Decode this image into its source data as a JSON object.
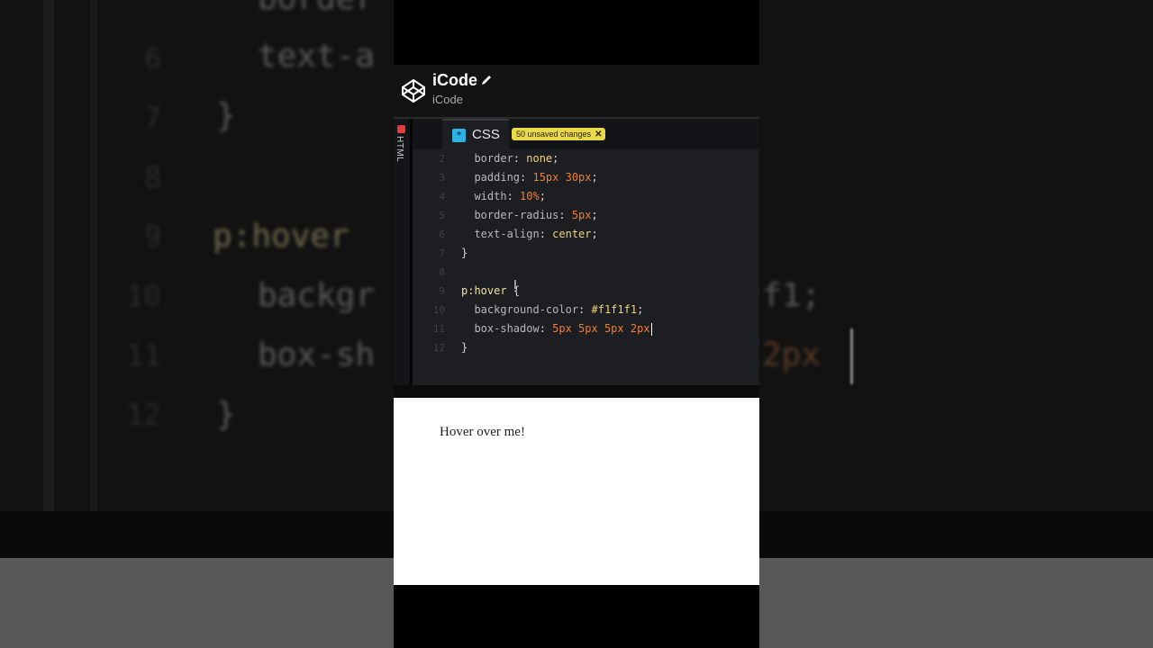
{
  "app": {
    "title": "iCode",
    "subtitle": "iCode",
    "logo_icon": "codepen-logo-icon",
    "edit_icon": "pencil-icon"
  },
  "editor": {
    "side_tab_label": "HTML",
    "active_tab": "CSS",
    "unsaved_badge": "50 unsaved changes",
    "unsaved_close": "✕",
    "lines": [
      {
        "num": "2",
        "tokens": [
          [
            "prop",
            "  border"
          ],
          [
            "punc",
            ": "
          ],
          [
            "val-yellow",
            "none"
          ],
          [
            "punc",
            ";"
          ]
        ]
      },
      {
        "num": "3",
        "tokens": [
          [
            "prop",
            "  padding"
          ],
          [
            "punc",
            ": "
          ],
          [
            "val-orange",
            "15px 30px"
          ],
          [
            "punc",
            ";"
          ]
        ]
      },
      {
        "num": "4",
        "tokens": [
          [
            "prop",
            "  width"
          ],
          [
            "punc",
            ": "
          ],
          [
            "val-orange",
            "10%"
          ],
          [
            "punc",
            ";"
          ]
        ]
      },
      {
        "num": "5",
        "tokens": [
          [
            "prop",
            "  border-radius"
          ],
          [
            "punc",
            ": "
          ],
          [
            "val-orange",
            "5px"
          ],
          [
            "punc",
            ";"
          ]
        ]
      },
      {
        "num": "6",
        "tokens": [
          [
            "prop",
            "  text-align"
          ],
          [
            "punc",
            ": "
          ],
          [
            "val-yellow",
            "center"
          ],
          [
            "punc",
            ";"
          ]
        ]
      },
      {
        "num": "7",
        "tokens": [
          [
            "punc",
            "}"
          ]
        ]
      },
      {
        "num": "8",
        "tokens": []
      },
      {
        "num": "9",
        "tokens": [
          [
            "sel",
            "p:hover "
          ],
          [
            "punc",
            "{"
          ]
        ]
      },
      {
        "num": "10",
        "tokens": [
          [
            "prop",
            "  background-color"
          ],
          [
            "punc",
            ": "
          ],
          [
            "val-yellow",
            "#f1f1f1"
          ],
          [
            "punc",
            ";"
          ]
        ]
      },
      {
        "num": "11",
        "tokens": [
          [
            "prop",
            "  box-shadow"
          ],
          [
            "punc",
            ": "
          ],
          [
            "val-orange",
            "5px 5px 5px 2px"
          ]
        ],
        "caret": true
      },
      {
        "num": "12",
        "tokens": [
          [
            "punc",
            "}"
          ]
        ]
      }
    ]
  },
  "preview": {
    "text": "Hover over me!"
  },
  "background": {
    "lines": [
      {
        "num": "",
        "text": "border"
      },
      {
        "num": "6",
        "text": "text-a"
      },
      {
        "num": "7",
        "text": "}"
      },
      {
        "num": "8",
        "text": ""
      },
      {
        "num": "9",
        "text": "p:hover"
      },
      {
        "num": "10",
        "text": "backgr"
      },
      {
        "num": "11",
        "text": "box-sh"
      },
      {
        "num": "12",
        "text": "}"
      }
    ],
    "right_fragments": [
      "f1;",
      "2px"
    ]
  },
  "colors": {
    "editor_bg": "#1d1e22",
    "css_icon": "#2fb1e6",
    "badge": "#e8d84a",
    "value_orange": "#ef7f35",
    "value_yellow": "#f2d279"
  }
}
